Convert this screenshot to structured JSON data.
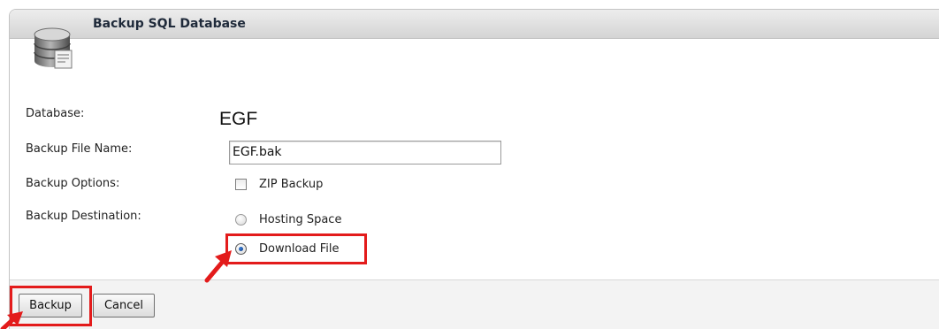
{
  "header": {
    "title": "Backup SQL Database",
    "icon": "database-backup-icon"
  },
  "form": {
    "database_label": "Database:",
    "database_value": "EGF",
    "file_name_label": "Backup File Name:",
    "file_name_value": "EGF.bak",
    "options_label": "Backup Options:",
    "zip_label": "ZIP Backup",
    "zip_checked": false,
    "destination_label": "Backup Destination:",
    "destinations": [
      {
        "label": "Hosting Space",
        "selected": false
      },
      {
        "label": "Download File",
        "selected": true
      }
    ]
  },
  "footer": {
    "backup_label": "Backup",
    "cancel_label": "Cancel"
  },
  "annotations": {
    "highlight_color": "#e31b1b",
    "arrow_color": "#e31b1b"
  }
}
